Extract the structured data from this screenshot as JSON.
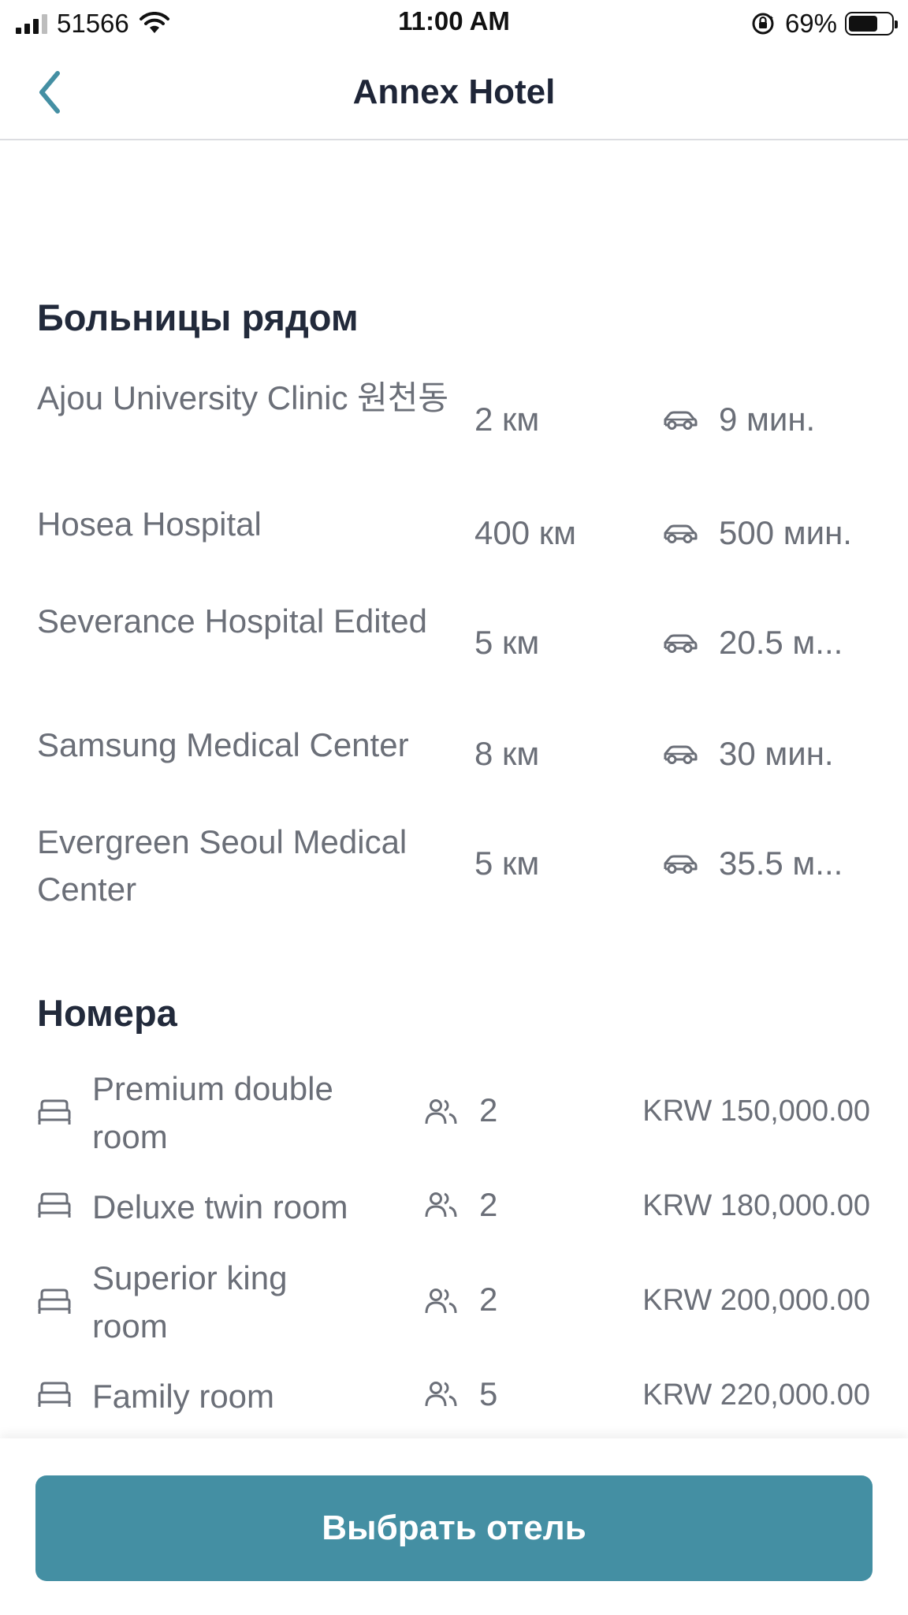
{
  "status_bar": {
    "carrier": "51566",
    "time": "11:00 AM",
    "battery_percent": "69%",
    "battery_level": 0.69
  },
  "nav": {
    "title": "Annex Hotel",
    "back_icon": "chevron-left-icon"
  },
  "hospitals": {
    "title": "Больницы рядом",
    "items": [
      {
        "name": "Ajou University Clinic 원천동",
        "distance": "2 км",
        "time": "9 мин."
      },
      {
        "name": "Hosea Hospital",
        "distance": "400 км",
        "time": "500 мин."
      },
      {
        "name": "Severance Hospital Edited",
        "distance": "5 км",
        "time": "20.5 м..."
      },
      {
        "name": "Samsung Medical Center",
        "distance": "8 км",
        "time": "30 мин."
      },
      {
        "name": "Evergreen Seoul Medical Center",
        "distance": "5 км",
        "time": "35.5 м..."
      }
    ]
  },
  "rooms": {
    "title": "Номера",
    "items": [
      {
        "name": "Premium double room",
        "guests": "2",
        "price": "KRW 150,000.00"
      },
      {
        "name": "Deluxe twin room",
        "guests": "2",
        "price": "KRW 180,000.00"
      },
      {
        "name": "Superior king room",
        "guests": "2",
        "price": "KRW 200,000.00"
      },
      {
        "name": "Family room",
        "guests": "5",
        "price": "KRW 220,000.00"
      }
    ]
  },
  "footer": {
    "select_button": "Выбрать отель"
  },
  "colors": {
    "accent": "#448fa3",
    "heading": "#222a3b",
    "text_secondary": "#6b6f78"
  }
}
